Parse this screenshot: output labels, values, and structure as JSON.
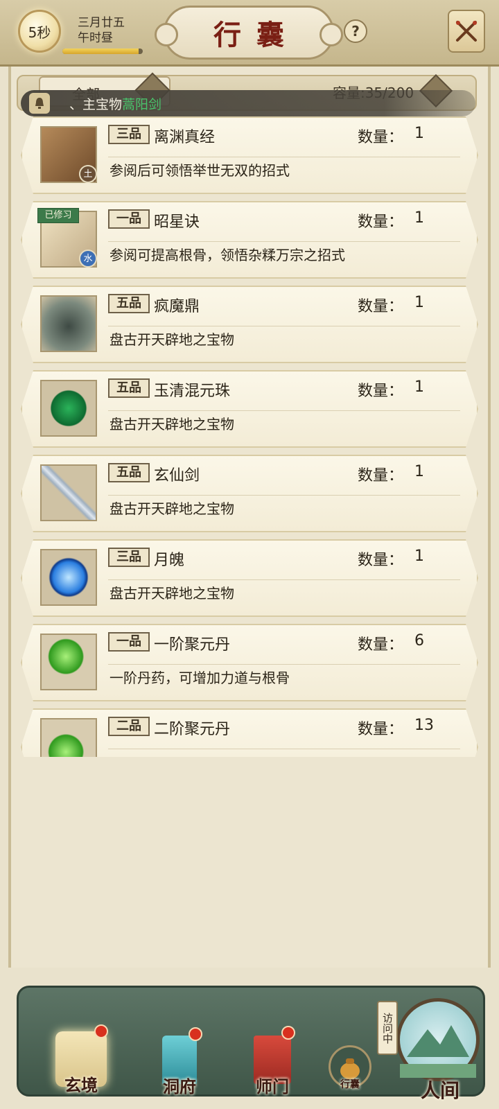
{
  "header": {
    "timer": "5秒",
    "date_line1": "三月廿五",
    "date_line2": "午时昼",
    "time_progress": 0.95,
    "title": "行囊"
  },
  "filter": {
    "category": "全部",
    "capacity": "容量:35/200"
  },
  "notice": {
    "prefix": "、主宝物",
    "item": "蒿阳剑"
  },
  "labels": {
    "qty": "数量："
  },
  "items": [
    {
      "grade": "三品",
      "name": "离渊真经",
      "qty": "1",
      "desc": "参阅后可领悟举世无双的招式",
      "element": "土",
      "icon": "book-icon"
    },
    {
      "grade": "一品",
      "name": "昭星诀",
      "qty": "1",
      "desc": "参阅可提高根骨，领悟杂糅万宗之招式",
      "element": "水",
      "badge": "已修习",
      "icon": "scroll-icon"
    },
    {
      "grade": "五品",
      "name": "疯魔鼎",
      "qty": "1",
      "desc": "盘古开天辟地之宝物",
      "icon": "cauldron-icon"
    },
    {
      "grade": "五品",
      "name": "玉清混元珠",
      "qty": "1",
      "desc": "盘古开天辟地之宝物",
      "icon": "jade-orb-icon"
    },
    {
      "grade": "五品",
      "name": "玄仙剑",
      "qty": "1",
      "desc": "盘古开天辟地之宝物",
      "icon": "sword-icon"
    },
    {
      "grade": "三品",
      "name": "月魄",
      "qty": "1",
      "desc": "盘古开天辟地之宝物",
      "icon": "pentagram-orb-icon"
    },
    {
      "grade": "一品",
      "name": "一阶聚元丹",
      "qty": "6",
      "desc": "一阶丹药，可增加力道与根骨",
      "icon": "green-pill-icon"
    },
    {
      "grade": "二品",
      "name": "二阶聚元丹",
      "qty": "13",
      "desc": "",
      "icon": "green-pill-icon"
    }
  ],
  "nav": {
    "xuanjing": "玄境",
    "dongfu": "洞府",
    "shimen": "师门",
    "xingnang": "行囊",
    "renjian": "人间",
    "visit_tag": "访问中"
  },
  "colors": {
    "title": "#7a1f14",
    "notice_item": "#49c26a",
    "panel_bg": "#ece5d0",
    "nav_tray": "#3f5648",
    "red_dot": "#d8301e"
  }
}
